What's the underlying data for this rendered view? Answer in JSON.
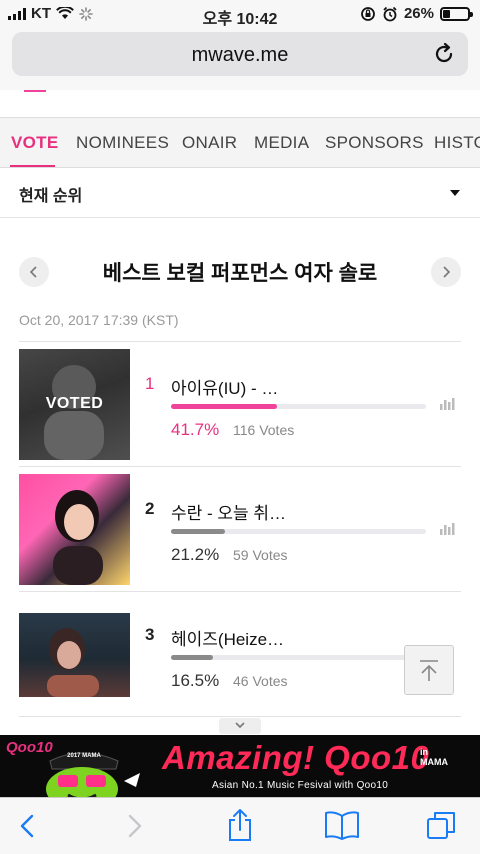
{
  "status_bar": {
    "carrier": "KT",
    "time": "오후 10:42",
    "battery": "26%",
    "battery_level": 0.26
  },
  "browser": {
    "url": "mwave.me"
  },
  "nav": {
    "tabs": [
      "VOTE",
      "NOMINEES",
      "ONAIR",
      "MEDIA",
      "SPONSORS",
      "HISTO"
    ],
    "active_index": 0
  },
  "ranking": {
    "dropdown_label": "현재 순위"
  },
  "category": {
    "title": "베스트 보컬 퍼포먼스 여자 솔로",
    "datetime": "Oct 20, 2017 17:39 (KST)"
  },
  "nominees": [
    {
      "rank": "1",
      "name": "아이유(IU) - …",
      "percent": "41.7%",
      "percent_value": 41.7,
      "votes": "116 Votes",
      "voted": true,
      "voted_label": "VOTED",
      "bar_color": "#f0429b"
    },
    {
      "rank": "2",
      "name": "수란 - 오늘 취…",
      "percent": "21.2%",
      "percent_value": 21.2,
      "votes": "59 Votes",
      "voted": false,
      "bar_color": "#8a8a8a"
    },
    {
      "rank": "3",
      "name": "헤이즈(Heize…",
      "percent": "16.5%",
      "percent_value": 16.5,
      "votes": "46 Votes",
      "voted": false,
      "bar_color": "#8a8a8a"
    }
  ],
  "ad": {
    "logo": "Qoo10",
    "badge": "2017 MAMA",
    "headline": "Amazing! Qoo10",
    "in_label": "in",
    "mama_label": "MAMA",
    "tagline": "Asian No.1 Music Fesival with Qoo10"
  },
  "colors": {
    "accent": "#e8307f",
    "ad_background": "#0a0a0a",
    "ad_headline": "#ff2a57"
  }
}
